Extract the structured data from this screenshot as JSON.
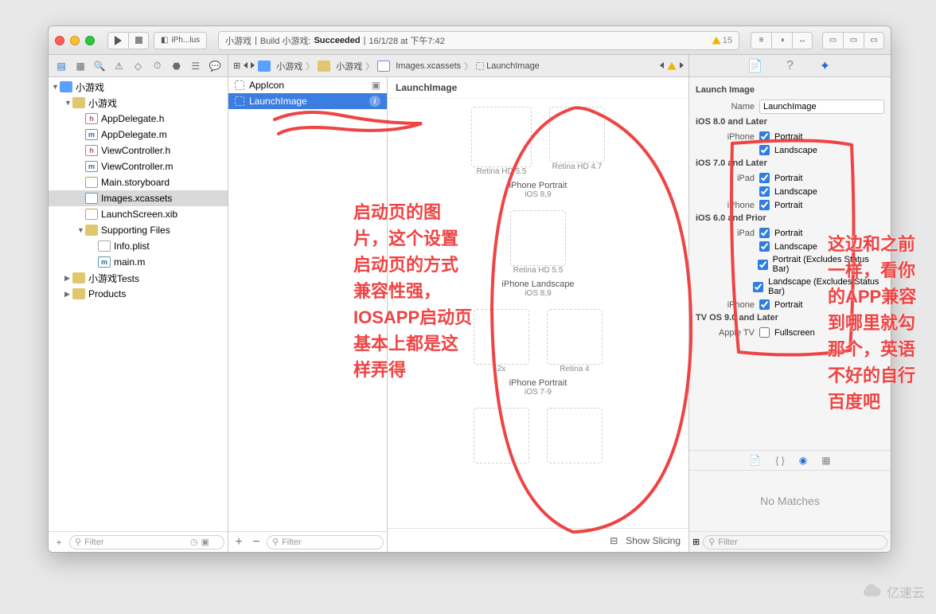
{
  "window": {
    "scheme_target": "iPh...lus",
    "scheme_app": "小游戏",
    "status": "Build 小游戏:",
    "status_result": "Succeeded",
    "status_time": "16/1/28 at 下午7:42",
    "warning_count": "15"
  },
  "navigator": {
    "filter_placeholder": "Filter",
    "tree": [
      {
        "label": "小游戏",
        "icon": "proj",
        "depth": 0,
        "open": true
      },
      {
        "label": "小游戏",
        "icon": "fold",
        "depth": 1,
        "open": true
      },
      {
        "label": "AppDelegate.h",
        "icon": "h",
        "depth": 2
      },
      {
        "label": "AppDelegate.m",
        "icon": "m",
        "depth": 2
      },
      {
        "label": "ViewController.h",
        "icon": "h",
        "depth": 2
      },
      {
        "label": "ViewController.m",
        "icon": "m",
        "depth": 2
      },
      {
        "label": "Main.storyboard",
        "icon": "sb",
        "depth": 2
      },
      {
        "label": "Images.xcassets",
        "icon": "as",
        "depth": 2,
        "sel": true
      },
      {
        "label": "LaunchScreen.xib",
        "icon": "xib",
        "depth": 2
      },
      {
        "label": "Supporting Files",
        "icon": "fold",
        "depth": 2,
        "open": true
      },
      {
        "label": "Info.plist",
        "icon": "pl",
        "depth": 3
      },
      {
        "label": "main.m",
        "icon": "m",
        "depth": 3
      },
      {
        "label": "小游戏Tests",
        "icon": "fold",
        "depth": 1,
        "open": false
      },
      {
        "label": "Products",
        "icon": "fold",
        "depth": 1,
        "open": false
      }
    ]
  },
  "jumpbar": {
    "back": "‹",
    "fwd": "›",
    "c1": "小游戏",
    "c2": "小游戏",
    "c3": "Images.xcassets",
    "c4": "LaunchImage"
  },
  "assets": {
    "appicon": "AppIcon",
    "launchimage": "LaunchImage",
    "filter_placeholder": "Filter"
  },
  "canvas": {
    "title": "LaunchImage",
    "slots": {
      "rhd55": "Retina HD 5.5",
      "rhd47": "Retina HD 4.7",
      "g1_title": "iPhone Portrait",
      "g1_sub": "iOS 8,9",
      "g2_title": "iPhone Landscape",
      "g2_sub": "iOS 8,9",
      "x2": "2x",
      "r4": "Retina 4",
      "g3_title": "iPhone Portrait",
      "g3_sub": "iOS 7-9"
    },
    "show_slicing": "Show Slicing"
  },
  "inspector": {
    "section": "Launch Image",
    "name_label": "Name",
    "name_value": "LaunchImage",
    "sections": [
      {
        "title": "iOS 8.0 and Later",
        "rows": [
          {
            "lbl": "iPhone",
            "opt": "Portrait",
            "chk": true
          },
          {
            "lbl": "",
            "opt": "Landscape",
            "chk": true
          }
        ]
      },
      {
        "title": "iOS 7.0 and Later",
        "rows": [
          {
            "lbl": "iPad",
            "opt": "Portrait",
            "chk": true
          },
          {
            "lbl": "",
            "opt": "Landscape",
            "chk": true
          },
          {
            "lbl": "iPhone",
            "opt": "Portrait",
            "chk": true
          }
        ]
      },
      {
        "title": "iOS 6.0 and Prior",
        "rows": [
          {
            "lbl": "iPad",
            "opt": "Portrait",
            "chk": true
          },
          {
            "lbl": "",
            "opt": "Landscape",
            "chk": true
          },
          {
            "lbl": "",
            "opt": "Portrait (Excludes Status Bar)",
            "chk": true
          },
          {
            "lbl": "",
            "opt": "Landscape (Excludes Status Bar)",
            "chk": true
          },
          {
            "lbl": "iPhone",
            "opt": "Portrait",
            "chk": true
          }
        ]
      },
      {
        "title": "TV OS 9.0 and Later",
        "rows": [
          {
            "lbl": "Apple TV",
            "opt": "Fullscreen",
            "chk": false
          }
        ]
      }
    ],
    "nomatch": "No Matches",
    "filter_placeholder": "Filter"
  },
  "annotations": {
    "left": "启动页的图片，这个设置启动页的方式兼容性强，IOSAPP启动页基本上都是这样弄得",
    "right": "这边和之前一样，看你的APP兼容到哪里就勾那个，英语不好的自行百度吧"
  },
  "watermark": "亿速云"
}
